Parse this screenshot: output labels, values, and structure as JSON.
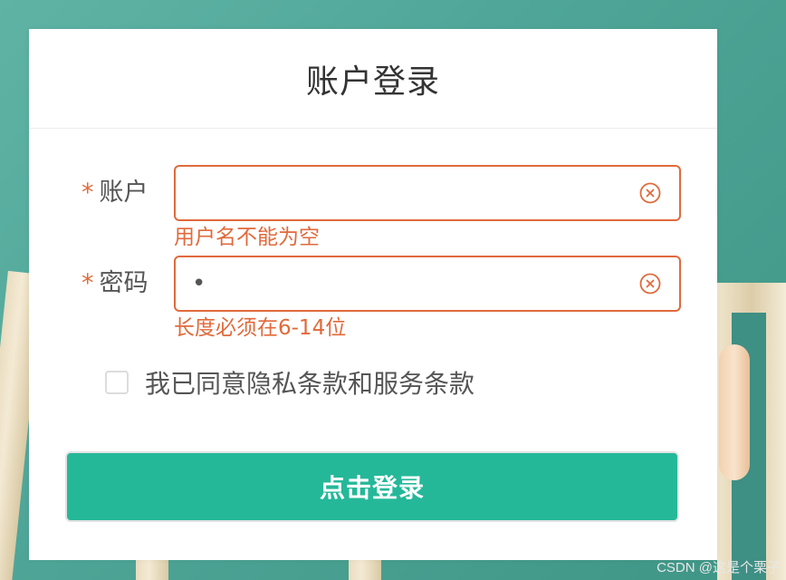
{
  "header": {
    "title": "账户登录"
  },
  "form": {
    "required_mark": "*",
    "account": {
      "label": "账户",
      "value": "",
      "error": "用户名不能为空"
    },
    "password": {
      "label": "密码",
      "value": "•",
      "error": "长度必须在6-14位"
    },
    "agreement": {
      "label": "我已同意隐私条款和服务条款",
      "checked": false
    },
    "submit_label": "点击登录"
  },
  "watermark": "CSDN @这是个栗子",
  "colors": {
    "accent": "#24b899",
    "error": "#e06a3c",
    "text": "#555555"
  },
  "icons": {
    "clear": "circle-x-icon"
  }
}
